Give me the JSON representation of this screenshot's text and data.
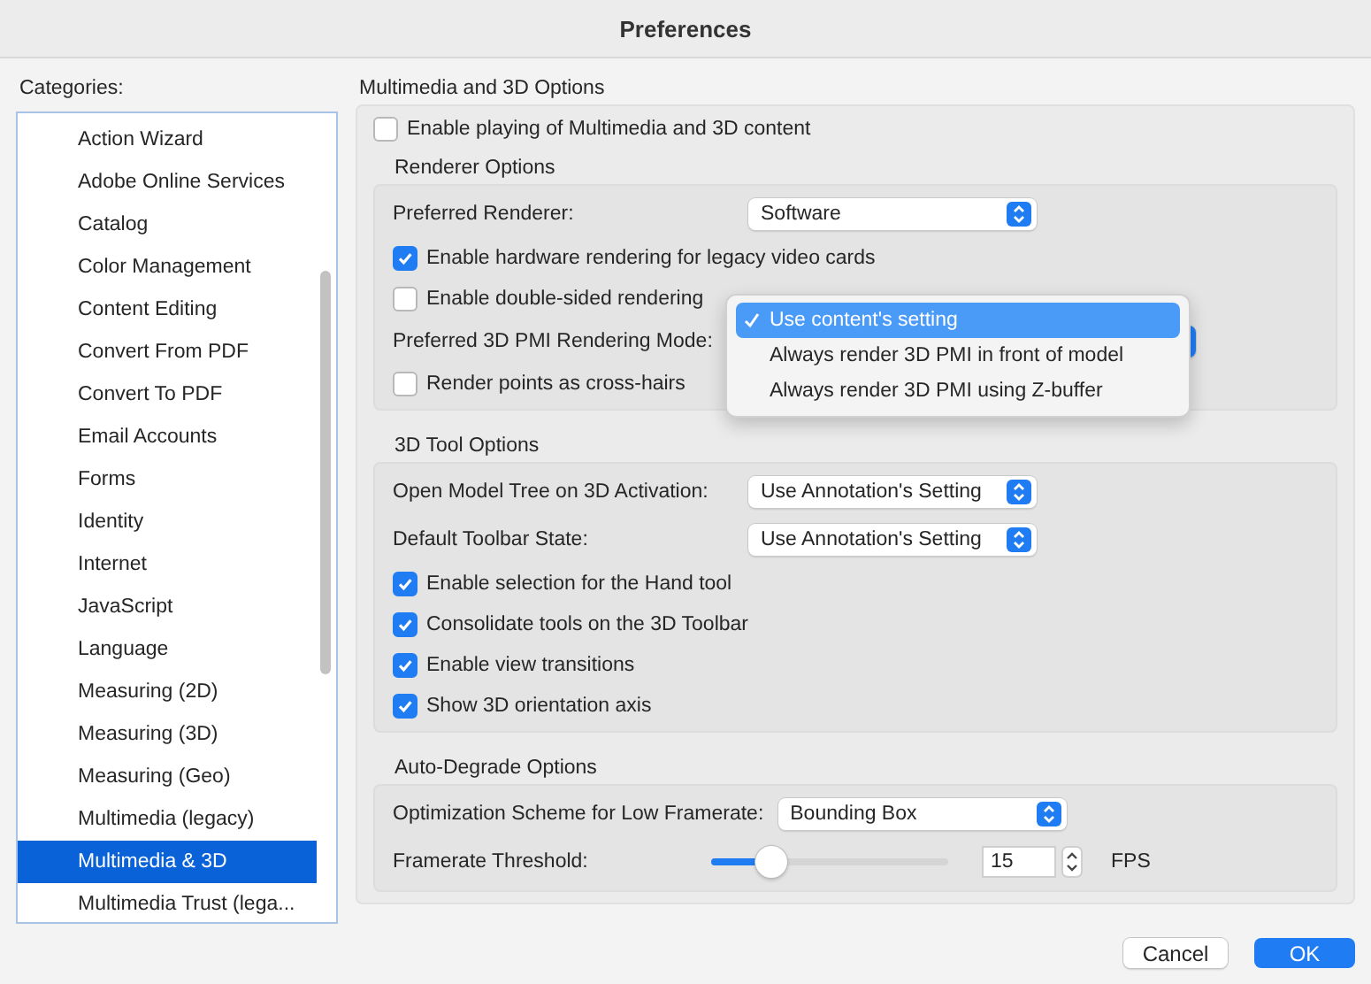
{
  "window": {
    "title": "Preferences"
  },
  "sidebar": {
    "label": "Categories:",
    "items": [
      {
        "label": "Action Wizard",
        "selected": false
      },
      {
        "label": "Adobe Online Services",
        "selected": false
      },
      {
        "label": "Catalog",
        "selected": false
      },
      {
        "label": "Color Management",
        "selected": false
      },
      {
        "label": "Content Editing",
        "selected": false
      },
      {
        "label": "Convert From PDF",
        "selected": false
      },
      {
        "label": "Convert To PDF",
        "selected": false
      },
      {
        "label": "Email Accounts",
        "selected": false
      },
      {
        "label": "Forms",
        "selected": false
      },
      {
        "label": "Identity",
        "selected": false
      },
      {
        "label": "Internet",
        "selected": false
      },
      {
        "label": "JavaScript",
        "selected": false
      },
      {
        "label": "Language",
        "selected": false
      },
      {
        "label": "Measuring (2D)",
        "selected": false
      },
      {
        "label": "Measuring (3D)",
        "selected": false
      },
      {
        "label": "Measuring (Geo)",
        "selected": false
      },
      {
        "label": "Multimedia (legacy)",
        "selected": false
      },
      {
        "label": "Multimedia & 3D",
        "selected": true
      },
      {
        "label": "Multimedia Trust (lega...",
        "selected": false
      }
    ]
  },
  "main": {
    "heading": "Multimedia and 3D Options",
    "enable_checkbox": {
      "label": "Enable playing of Multimedia and 3D content",
      "checked": false
    },
    "sections": [
      {
        "title": "Renderer Options",
        "rows": [
          {
            "kind": "select",
            "label": "Preferred Renderer:",
            "value": "Software"
          },
          {
            "kind": "checkbox",
            "label": "Enable hardware rendering for legacy video cards",
            "checked": true
          },
          {
            "kind": "checkbox",
            "label": "Enable double-sided rendering",
            "checked": false
          },
          {
            "kind": "open_select",
            "label": "Preferred 3D PMI Rendering Mode:",
            "options": [
              {
                "label": "Use content's setting",
                "selected": true
              },
              {
                "label": "Always render 3D PMI in front of model",
                "selected": false
              },
              {
                "label": "Always render 3D PMI using Z-buffer",
                "selected": false
              }
            ]
          },
          {
            "kind": "checkbox",
            "label": "Render points as cross-hairs",
            "checked": false
          }
        ]
      },
      {
        "title": "3D Tool Options",
        "rows": [
          {
            "kind": "select",
            "label": "Open Model Tree on 3D Activation:",
            "value": "Use Annotation's Setting"
          },
          {
            "kind": "select",
            "label": "Default Toolbar State:",
            "value": "Use Annotation's Setting"
          },
          {
            "kind": "checkbox",
            "label": "Enable selection for the Hand tool",
            "checked": true
          },
          {
            "kind": "checkbox",
            "label": "Consolidate tools on the 3D Toolbar",
            "checked": true
          },
          {
            "kind": "checkbox",
            "label": "Enable view transitions",
            "checked": true
          },
          {
            "kind": "checkbox",
            "label": "Show 3D orientation axis",
            "checked": true
          }
        ]
      },
      {
        "title": "Auto-Degrade Options",
        "rows": [
          {
            "kind": "select",
            "label": "Optimization Scheme for Low Framerate:",
            "value": "Bounding Box"
          },
          {
            "kind": "slider",
            "label": "Framerate Threshold:",
            "level": 0.25,
            "value": "15",
            "unit": "FPS"
          }
        ]
      }
    ]
  },
  "buttons": [
    {
      "label": "Cancel",
      "kind": "secondary"
    },
    {
      "label": "OK",
      "kind": "primary"
    }
  ]
}
